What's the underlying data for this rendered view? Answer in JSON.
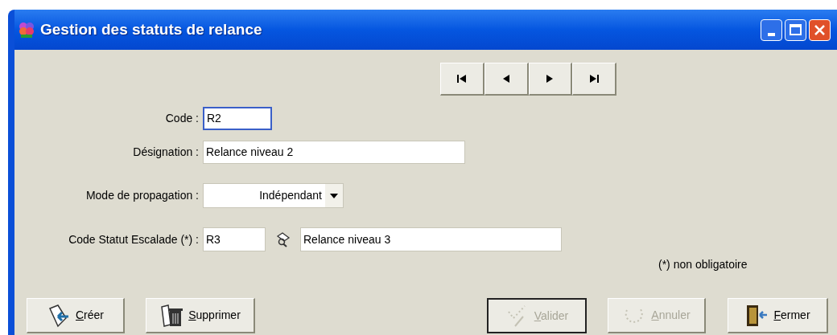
{
  "window": {
    "title": "Gestion des statuts de relance"
  },
  "navigation": [
    {
      "kind": "first"
    },
    {
      "kind": "previous"
    },
    {
      "kind": "next"
    },
    {
      "kind": "last"
    }
  ],
  "fields": [
    {
      "kind": "text",
      "label": "Code :",
      "value": "R2",
      "focused": true
    },
    {
      "kind": "text",
      "label": "Désignation :",
      "value": "Relance niveau 2",
      "focused": false
    },
    {
      "kind": "combo",
      "label": "Mode de propagation :",
      "value": "Indépendant",
      "focused": false
    },
    {
      "kind": "lookup",
      "label": "Code Statut Escalade (*) :",
      "value": "R3",
      "description": "Relance niveau 3",
      "focused": false
    }
  ],
  "note": "(*) non obligatoire",
  "buttons": [
    {
      "label": "Créer",
      "kind": "create",
      "disabled": false,
      "default": false
    },
    {
      "label": "Supprimer",
      "kind": "delete",
      "disabled": false,
      "default": false
    },
    {
      "label": "Valider",
      "kind": "validate",
      "disabled": true,
      "default": true
    },
    {
      "label": "Annuler",
      "kind": "cancel",
      "disabled": true,
      "default": false
    },
    {
      "label": "Fermer",
      "kind": "close",
      "disabled": false,
      "default": false
    }
  ]
}
